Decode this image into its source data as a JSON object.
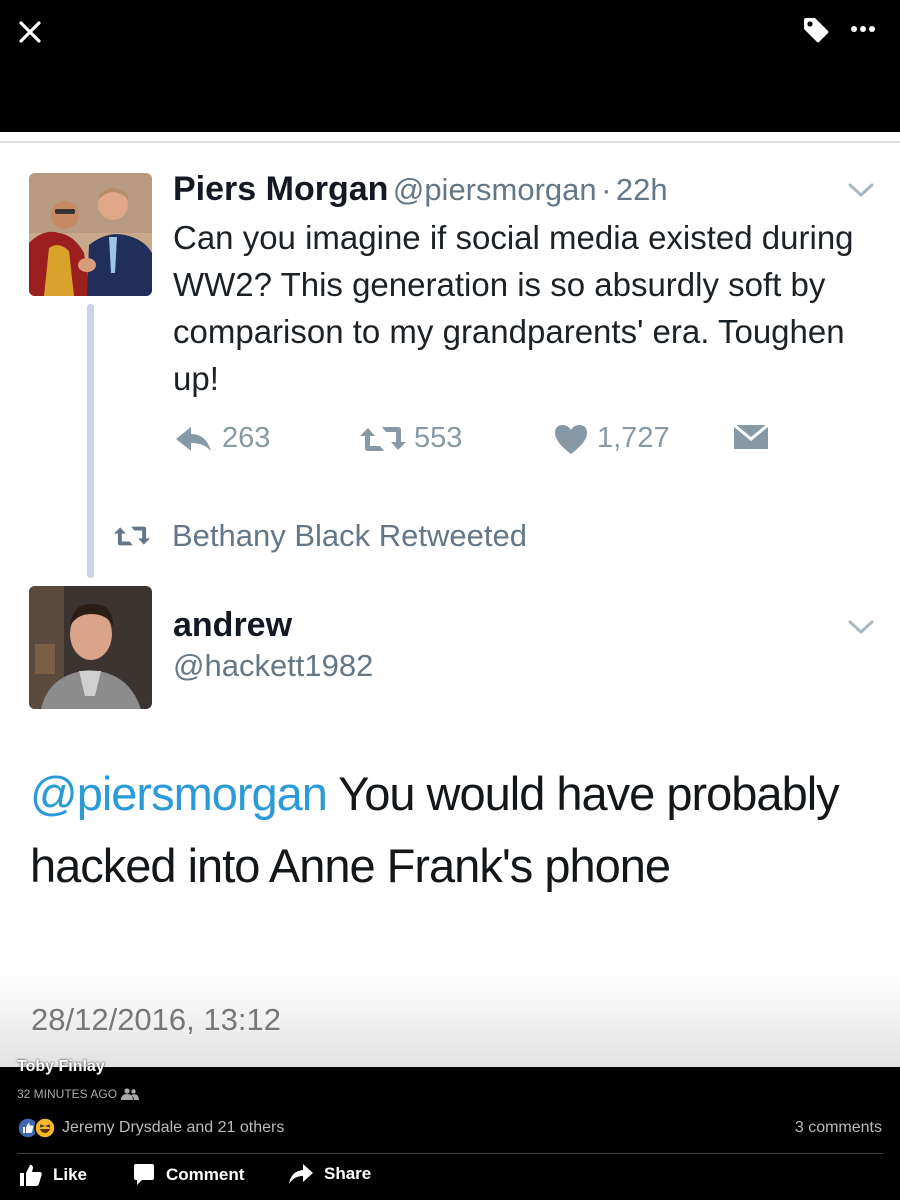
{
  "viewer": {
    "close_icon": "close-icon",
    "tag_icon": "tag-icon",
    "more_icon": "more-icon"
  },
  "tweet1": {
    "name": "Piers Morgan",
    "handle": "@piersmorgan",
    "separator": "·",
    "age": "22h",
    "text": "Can you imagine if social media existed during WW2? This generation is so absurdly soft by comparison to my grandparents' era. Toughen up!",
    "reply_count": "263",
    "retweet_count": "553",
    "like_count": "1,727"
  },
  "retweet_notice": "Bethany Black Retweeted",
  "tweet2": {
    "name": "andrew",
    "handle": "@hackett1982",
    "mention": "@piersmorgan",
    "text": " You would have probably hacked into Anne Frank's phone",
    "timestamp": "28/12/2016, 13:12"
  },
  "facebook": {
    "poster": "Toby Finlay",
    "time": "32 MINUTES AGO",
    "reactions_text": "Jeremy Drysdale and 21 others",
    "comments": "3 comments",
    "like_label": "Like",
    "comment_label": "Comment",
    "share_label": "Share"
  },
  "colors": {
    "mention": "#2b9ad8",
    "muted": "#8899a6",
    "like_badge": "#4267b2",
    "haha_badge": "#f7b928"
  }
}
